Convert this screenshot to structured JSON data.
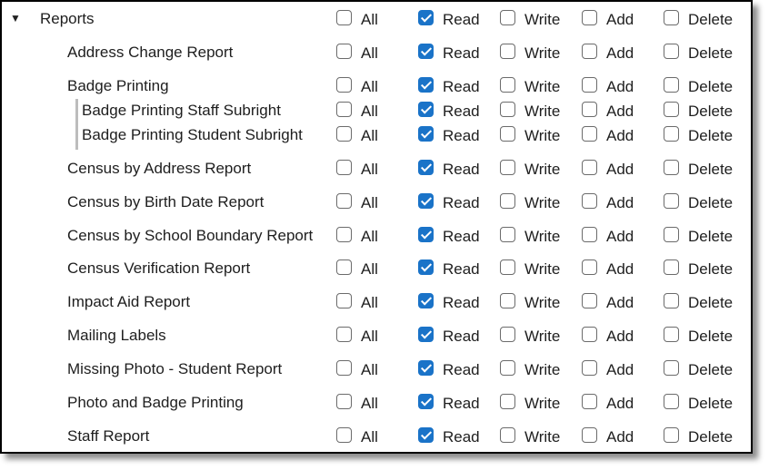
{
  "permission_labels": {
    "all": "All",
    "read": "Read",
    "write": "Write",
    "add": "Add",
    "delete": "Delete"
  },
  "colors": {
    "checked": "#1a73c8"
  },
  "rows": [
    {
      "label": "Reports",
      "level": 0,
      "expanded": true,
      "toggle_icon": "▼",
      "all": false,
      "read": true,
      "write": false,
      "add": false,
      "delete": false
    },
    {
      "label": "Address Change Report",
      "level": 1,
      "all": false,
      "read": true,
      "write": false,
      "add": false,
      "delete": false
    },
    {
      "label": "Badge Printing",
      "level": 1,
      "all": false,
      "read": true,
      "write": false,
      "add": false,
      "delete": false
    },
    {
      "label": "Badge Printing Staff Subright",
      "level": 2,
      "all": false,
      "read": true,
      "write": false,
      "add": false,
      "delete": false
    },
    {
      "label": "Badge Printing Student Subright",
      "level": 2,
      "all": false,
      "read": true,
      "write": false,
      "add": false,
      "delete": false
    },
    {
      "label": "Census by Address Report",
      "level": 1,
      "all": false,
      "read": true,
      "write": false,
      "add": false,
      "delete": false
    },
    {
      "label": "Census by Birth Date Report",
      "level": 1,
      "all": false,
      "read": true,
      "write": false,
      "add": false,
      "delete": false
    },
    {
      "label": "Census by School Boundary Report",
      "level": 1,
      "all": false,
      "read": true,
      "write": false,
      "add": false,
      "delete": false
    },
    {
      "label": "Census Verification Report",
      "level": 1,
      "all": false,
      "read": true,
      "write": false,
      "add": false,
      "delete": false
    },
    {
      "label": "Impact Aid Report",
      "level": 1,
      "all": false,
      "read": true,
      "write": false,
      "add": false,
      "delete": false
    },
    {
      "label": "Mailing Labels",
      "level": 1,
      "all": false,
      "read": true,
      "write": false,
      "add": false,
      "delete": false
    },
    {
      "label": "Missing Photo - Student Report",
      "level": 1,
      "all": false,
      "read": true,
      "write": false,
      "add": false,
      "delete": false
    },
    {
      "label": "Photo and Badge Printing",
      "level": 1,
      "all": false,
      "read": true,
      "write": false,
      "add": false,
      "delete": false
    },
    {
      "label": "Staff Report",
      "level": 1,
      "all": false,
      "read": true,
      "write": false,
      "add": false,
      "delete": false
    }
  ]
}
